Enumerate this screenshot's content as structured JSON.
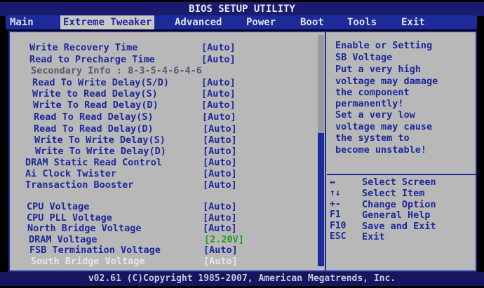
{
  "title": "BIOS SETUP UTILITY",
  "menu": [
    {
      "label": "Main"
    },
    {
      "label": "Extreme Tweaker"
    },
    {
      "label": "Advanced"
    },
    {
      "label": "Power"
    },
    {
      "label": "Boot"
    },
    {
      "label": "Tools"
    },
    {
      "label": "Exit"
    }
  ],
  "settings": [
    {
      "label": "Write Recovery Time",
      "value": "[Auto]"
    },
    {
      "label": "Read to Precharge Time",
      "value": "[Auto]"
    },
    {
      "label": "Secondary Info : 8-3-5-4-6-4-6",
      "value": ""
    },
    {
      "label": "Read To Write Delay(S/D)",
      "value": "[Auto]"
    },
    {
      "label": "Write to Read Delay(S)",
      "value": "[Auto]"
    },
    {
      "label": "Write To Read Delay(D)",
      "value": "[Auto]"
    },
    {
      "label": "Read To Read Delay(S)",
      "value": "[Auto]"
    },
    {
      "label": "Read To Read Delay(D)",
      "value": "[Auto]"
    },
    {
      "label": "Write To Write Delay(S)",
      "value": "[Auto]"
    },
    {
      "label": "Write To Write Delay(D)",
      "value": "[Auto]"
    },
    {
      "label": "DRAM Static Read Control",
      "value": "[Auto]"
    },
    {
      "label": "Ai Clock Twister",
      "value": "[Auto]"
    },
    {
      "label": "Transaction Booster",
      "value": "[Auto]"
    },
    {
      "label": "CPU Voltage",
      "value": "[Auto]"
    },
    {
      "label": "CPU PLL Voltage",
      "value": "[Auto]"
    },
    {
      "label": "North Bridge Voltage",
      "value": "[Auto]"
    },
    {
      "label": "DRAM Voltage",
      "value": "[2.20V]"
    },
    {
      "label": "FSB Termination Voltage",
      "value": "[Auto]"
    },
    {
      "label": "South Bridge Voltage",
      "value": "[Auto]"
    }
  ],
  "help_text": [
    "Enable or Setting",
    "SB Voltage",
    "Put a very high",
    "voltage may damage",
    "the component",
    "permanently!",
    "Set a very low",
    "voltage may cause",
    "the system to",
    "become unstable!"
  ],
  "key_help": [
    {
      "key": "↔",
      "desc": "Select Screen"
    },
    {
      "key": "↑↓",
      "desc": "Select Item"
    },
    {
      "key": "+-",
      "desc": "Change Option"
    },
    {
      "key": "F1",
      "desc": "General Help"
    },
    {
      "key": "F10",
      "desc": "Save and Exit"
    },
    {
      "key": "ESC",
      "desc": "Exit"
    }
  ],
  "footer": "v02.61 (C)Copyright 1985-2007, American Megatrends, Inc.",
  "colors": {
    "bios_blue": "#1d2a9a",
    "panel_gray": "#b8b8b8",
    "value_green": "#20a020",
    "highlight_white": "#e6e6e6"
  }
}
